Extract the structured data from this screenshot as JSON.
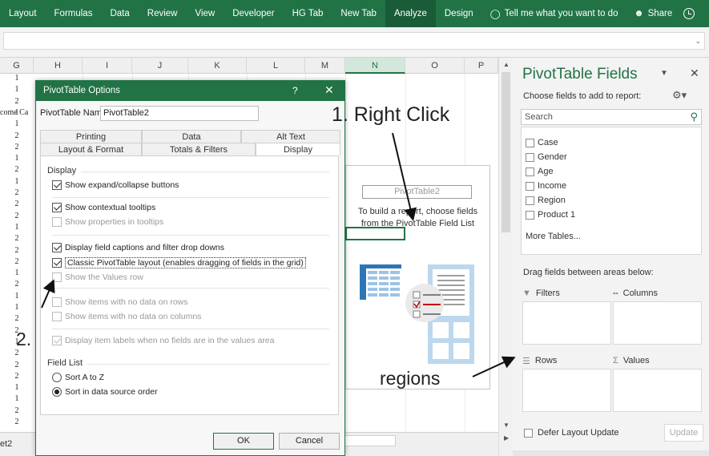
{
  "ribbon": {
    "tabs": [
      {
        "label": "Layout"
      },
      {
        "label": "Formulas"
      },
      {
        "label": "Data"
      },
      {
        "label": "Review"
      },
      {
        "label": "View"
      },
      {
        "label": "Developer"
      },
      {
        "label": "HG Tab"
      },
      {
        "label": "New Tab"
      },
      {
        "label": "Analyze"
      },
      {
        "label": "Design"
      }
    ],
    "active_tab": "Analyze",
    "tell_me": "Tell me what you want to do",
    "share": "Share",
    "accent_color": "#217346"
  },
  "sheet": {
    "columns": [
      "G",
      "H",
      "I",
      "J",
      "K",
      "L",
      "M",
      "N",
      "O",
      "P"
    ],
    "selected_column": "N",
    "partial_cell_text": "come Ca",
    "row_values": [
      "1",
      "1",
      "2",
      "1",
      "1",
      "2",
      "2",
      "1",
      "2",
      "1",
      "2",
      "2",
      "2",
      "1",
      "2",
      "2",
      "2",
      "1",
      "2",
      "1",
      "1",
      "2",
      "2",
      "1",
      "2",
      "2",
      "2",
      "1",
      "1",
      "2",
      "2"
    ],
    "sheet_tab": "et2",
    "pivot_placeholder": {
      "name": "PivotTable2",
      "instructions_line1": "To build a report, choose fields",
      "instructions_line2": "from the PivotTable Field List"
    }
  },
  "dialog": {
    "title": "PivotTable Options",
    "help_glyph": "?",
    "close_glyph": "✕",
    "name_label": "PivotTable Name:",
    "name_value": "PivotTable2",
    "tabs_row1": [
      "Printing",
      "Data",
      "Alt Text"
    ],
    "tabs_row2": [
      "Layout & Format",
      "Totals & Filters",
      "Display"
    ],
    "active_tab": "Display",
    "display_section": "Display",
    "options": [
      {
        "label": "Show expand/collapse buttons",
        "checked": true,
        "enabled": true
      },
      {
        "label": "Show contextual tooltips",
        "checked": true,
        "enabled": true
      },
      {
        "label": "Show properties in tooltips",
        "checked": false,
        "enabled": false
      },
      {
        "label": "Display field captions and filter drop downs",
        "checked": true,
        "enabled": true
      },
      {
        "label": "Classic PivotTable layout (enables dragging of fields in the grid)",
        "checked": true,
        "enabled": true
      },
      {
        "label": "Show the Values row",
        "checked": false,
        "enabled": false
      },
      {
        "label": "Show items with no data on rows",
        "checked": false,
        "enabled": false
      },
      {
        "label": "Show items with no data on columns",
        "checked": false,
        "enabled": false
      },
      {
        "label": "Display item labels when no fields are in the values area",
        "checked": true,
        "enabled": false
      }
    ],
    "field_list_section": "Field List",
    "sort_options": [
      {
        "label": "Sort A to Z",
        "selected": false
      },
      {
        "label": "Sort in data source order",
        "selected": true
      }
    ],
    "ok_label": "OK",
    "cancel_label": "Cancel"
  },
  "fields_panel": {
    "title": "PivotTable Fields",
    "choose_label": "Choose fields to add to report:",
    "search_placeholder": "Search",
    "fields": [
      "Case",
      "Gender",
      "Age",
      "Income",
      "Region",
      "Product 1"
    ],
    "more_tables": "More Tables...",
    "drag_label": "Drag fields between areas below:",
    "areas": [
      {
        "label": "Filters",
        "icon": "filter-icon"
      },
      {
        "label": "Columns",
        "icon": "columns-icon"
      },
      {
        "label": "Rows",
        "icon": "rows-icon"
      },
      {
        "label": "Values",
        "icon": "sigma-icon"
      }
    ],
    "defer_label": "Defer Layout Update",
    "update_label": "Update"
  },
  "annotations": {
    "step1": "1. Right Click",
    "step2": "2.",
    "regions": "regions"
  }
}
